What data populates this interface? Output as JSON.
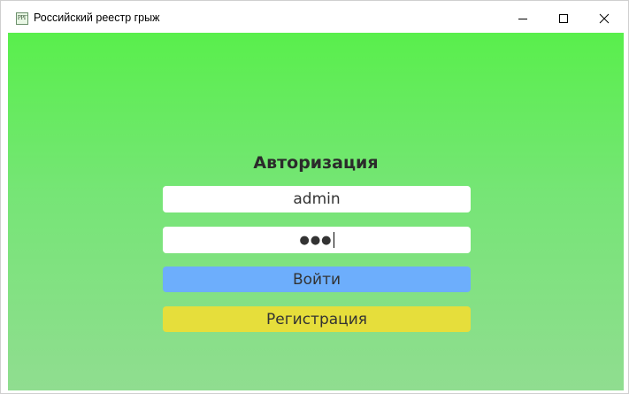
{
  "window": {
    "icon_text": "РРГ",
    "title": "Российский реестр грыж",
    "controls": {
      "minimize_icon": "minimize-icon",
      "maximize_icon": "maximize-icon",
      "close_icon": "close-icon"
    }
  },
  "form": {
    "heading": "Авторизация",
    "login_value": "admin",
    "password_mask": "●●●",
    "login_button": "Войти",
    "register_button": "Регистрация"
  },
  "colors": {
    "background_top": "#59ef4c",
    "background_bottom": "#90dd90",
    "login_button": "#6daefc",
    "register_button": "#e6de3b"
  }
}
